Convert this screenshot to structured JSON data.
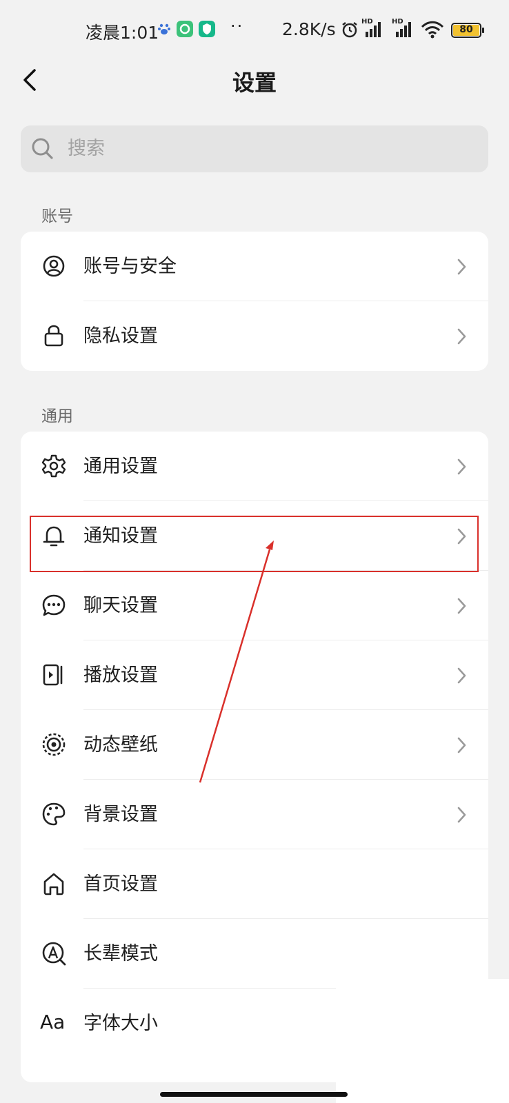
{
  "status_bar": {
    "time": "凌晨1:01",
    "dots": "··",
    "speed": "2.8K/s",
    "hd_1": "HD",
    "hd_2": "HD",
    "battery": "80",
    "colors": {
      "battery": "#f2c230",
      "notif_green": "#3cc27a",
      "notif_teal": "#16b88a"
    }
  },
  "header": {
    "title": "设置"
  },
  "search": {
    "placeholder": "搜索"
  },
  "sections": [
    {
      "label": "账号",
      "items": [
        {
          "label": "账号与安全",
          "icon": "user-circle-icon"
        },
        {
          "label": "隐私设置",
          "icon": "lock-icon"
        }
      ]
    },
    {
      "label": "通用",
      "items": [
        {
          "label": "通用设置",
          "icon": "gear-icon"
        },
        {
          "label": "通知设置",
          "icon": "bell-icon"
        },
        {
          "label": "聊天设置",
          "icon": "chat-bubble-icon"
        },
        {
          "label": "播放设置",
          "icon": "play-panel-icon"
        },
        {
          "label": "动态壁纸",
          "icon": "live-wallpaper-icon"
        },
        {
          "label": "背景设置",
          "icon": "palette-icon"
        },
        {
          "label": "首页设置",
          "icon": "home-icon"
        },
        {
          "label": "长辈模式",
          "icon": "elder-mode-icon"
        },
        {
          "label": "字体大小",
          "icon": "font-size-icon"
        }
      ]
    }
  ],
  "font_size_glyph": "Aa",
  "annotation": {
    "highlight_color": "#d9302b",
    "highlighted_item": "通知设置"
  }
}
